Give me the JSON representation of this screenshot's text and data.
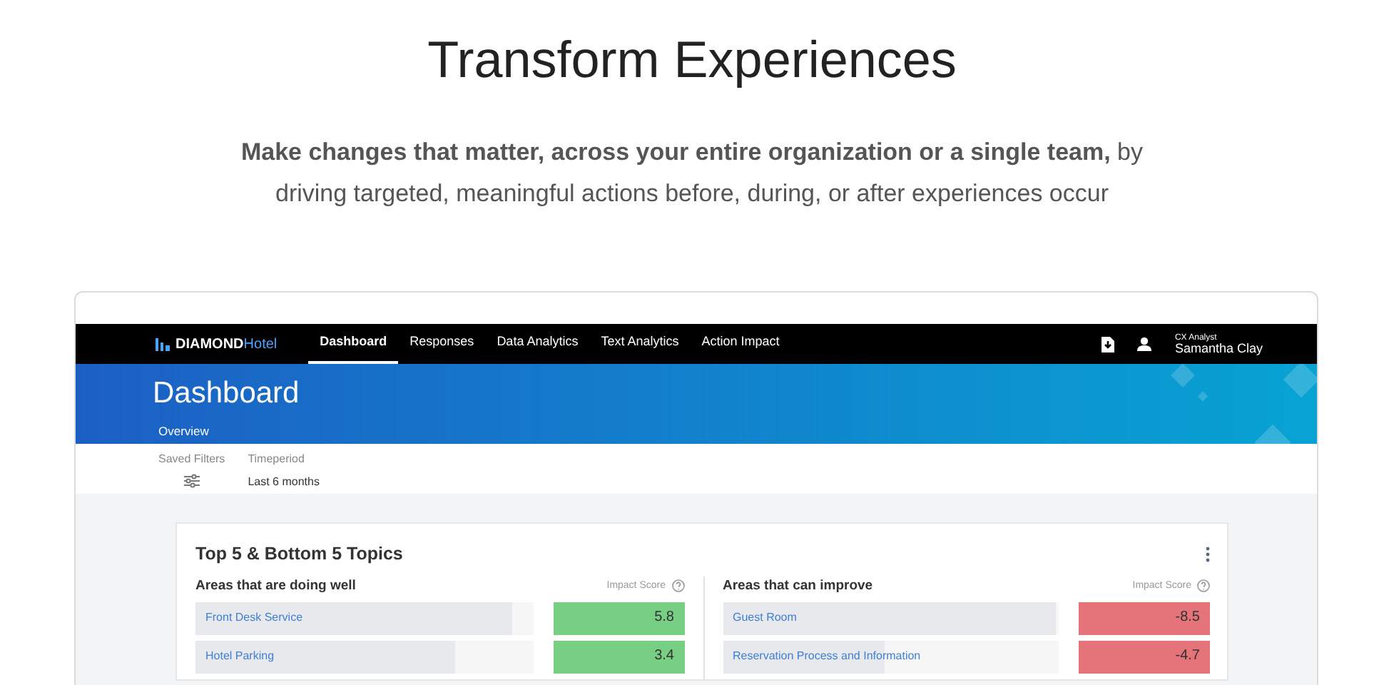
{
  "hero": {
    "title": "Transform Experiences",
    "subtitle": "**Make changes that matter, across your entire organization or a single team,** by driving targeted, meaningful actions before, during, or after experiences occur"
  },
  "app": {
    "logo": {
      "brand": "DIAMOND",
      "suffix": "Hotel"
    },
    "nav": [
      {
        "label": "Dashboard",
        "selected": true
      },
      {
        "label": "Responses",
        "selected": false
      },
      {
        "label": "Data Analytics",
        "selected": false
      },
      {
        "label": "Text Analytics",
        "selected": false
      },
      {
        "label": "Action Impact",
        "selected": false
      }
    ],
    "user": {
      "role": "CX Analyst",
      "name": "Samantha Clay"
    },
    "page_title": "Dashboard",
    "subtabs": [
      {
        "label": "Overview",
        "selected": true
      }
    ],
    "filters": {
      "saved_filters_label": "Saved Filters",
      "timeperiod_label": "Timeperiod",
      "timeperiod_value": "Last 6 months"
    },
    "card": {
      "title": "Top 5 & Bottom 5 Topics",
      "sections": [
        {
          "title": "Areas that are doing well",
          "score_label": "Impact Score",
          "rows": [
            {
              "topic": "Front Desk Service",
              "score": "5.8",
              "level": 0.94,
              "color": "#77cf83"
            },
            {
              "topic": "Hotel Parking",
              "score": "3.4",
              "level": 0.77,
              "color": "#77cf83"
            }
          ]
        },
        {
          "title": "Areas that can improve",
          "score_label": "Impact Score",
          "rows": [
            {
              "topic": "Guest Room",
              "score": "-8.5",
              "level": 0.99,
              "color": "#e5737a"
            },
            {
              "topic": "Reservation Process and Information",
              "score": "-4.7",
              "level": 0.48,
              "color": "#e5737a"
            }
          ]
        }
      ]
    }
  }
}
